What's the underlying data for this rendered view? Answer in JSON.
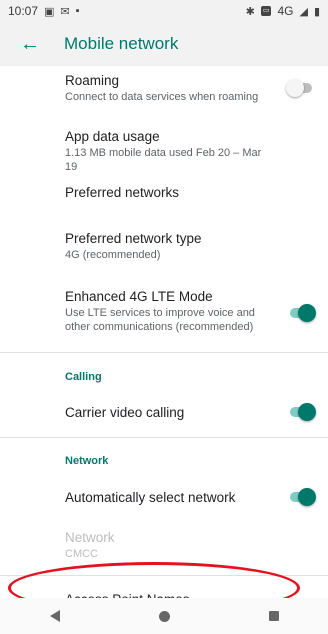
{
  "status_bar": {
    "time": "10:07",
    "network_label": "4G"
  },
  "app_bar": {
    "title": "Mobile network"
  },
  "settings": {
    "roaming": {
      "title": "Roaming",
      "summary": "Connect to data services when roaming"
    },
    "app_data_usage": {
      "title": "App data usage",
      "summary": "1.13 MB mobile data used Feb 20 – Mar 19"
    },
    "preferred_networks": {
      "title": "Preferred networks"
    },
    "preferred_network_type": {
      "title": "Preferred network type",
      "summary": "4G (recommended)"
    },
    "enhanced_4g_lte": {
      "title": "Enhanced 4G LTE Mode",
      "summary": "Use LTE services to improve voice and other communications (recommended)"
    },
    "calling_category": "Calling",
    "carrier_video_calling": {
      "title": "Carrier video calling"
    },
    "network_category": "Network",
    "auto_select_network": {
      "title": "Automatically select network"
    },
    "network": {
      "title": "Network",
      "summary": "CMCC"
    },
    "access_point_names": {
      "title": "Access Point Names"
    }
  },
  "colors": {
    "accent": "#00796b",
    "annotation": "#e3121f"
  }
}
